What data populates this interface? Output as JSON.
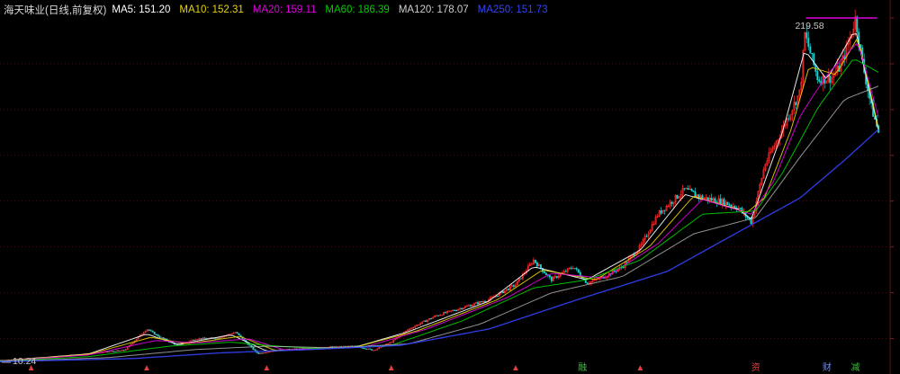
{
  "header": {
    "title": "海天味业",
    "period": "(日线,前复权)"
  },
  "chart_data": {
    "type": "candlestick",
    "max_label": "219.58",
    "min_label": "10.24",
    "y_max": 219.58,
    "y_min": 10.24,
    "ma_legend": [
      {
        "label": "MA5:",
        "value": "151.20",
        "color": "#ffffff"
      },
      {
        "label": "MA10:",
        "value": "152.31",
        "color": "#e8d400"
      },
      {
        "label": "MA20:",
        "value": "159.11",
        "color": "#e000e0"
      },
      {
        "label": "MA60:",
        "value": "186.39",
        "color": "#00d000"
      },
      {
        "label": "MA120:",
        "value": "178.07",
        "color": "#cfcfcf"
      },
      {
        "label": "MA250:",
        "value": "151.73",
        "color": "#3344ff"
      }
    ],
    "series_path": [
      [
        0,
        10.8
      ],
      [
        0.02,
        11.2
      ],
      [
        0.05,
        12.2
      ],
      [
        0.08,
        14.0
      ],
      [
        0.11,
        15.5
      ],
      [
        0.14,
        17.0
      ],
      [
        0.165,
        30.0
      ],
      [
        0.18,
        25.0
      ],
      [
        0.2,
        20.0
      ],
      [
        0.22,
        24.0
      ],
      [
        0.245,
        24.5
      ],
      [
        0.265,
        28.0
      ],
      [
        0.29,
        15.0
      ],
      [
        0.31,
        17.0
      ],
      [
        0.34,
        18.0
      ],
      [
        0.37,
        19.0
      ],
      [
        0.4,
        19.5
      ],
      [
        0.42,
        17.0
      ],
      [
        0.44,
        22.0
      ],
      [
        0.46,
        30.0
      ],
      [
        0.49,
        38.0
      ],
      [
        0.52,
        43.0
      ],
      [
        0.55,
        48.0
      ],
      [
        0.58,
        57.0
      ],
      [
        0.6,
        72.0
      ],
      [
        0.62,
        60.0
      ],
      [
        0.645,
        68.0
      ],
      [
        0.66,
        58.0
      ],
      [
        0.68,
        62.0
      ],
      [
        0.7,
        68.0
      ],
      [
        0.72,
        80.0
      ],
      [
        0.74,
        100.0
      ],
      [
        0.77,
        115.0
      ],
      [
        0.79,
        110.0
      ],
      [
        0.81,
        108.0
      ],
      [
        0.83,
        104.0
      ],
      [
        0.845,
        95.0
      ],
      [
        0.86,
        130.0
      ],
      [
        0.88,
        152.0
      ],
      [
        0.9,
        175.0
      ],
      [
        0.905,
        210.0
      ],
      [
        0.92,
        182.0
      ],
      [
        0.935,
        183.0
      ],
      [
        0.945,
        190.0
      ],
      [
        0.955,
        206.0
      ],
      [
        0.962,
        219.58
      ],
      [
        0.97,
        192.0
      ],
      [
        0.98,
        165.0
      ],
      [
        0.988,
        150.0
      ]
    ],
    "ma_paths": [
      {
        "name": "MA5",
        "color": "#ffffff",
        "values": [
          [
            0,
            10.6
          ],
          [
            0.1,
            14.8
          ],
          [
            0.165,
            27.0
          ],
          [
            0.2,
            20.5
          ],
          [
            0.26,
            26.5
          ],
          [
            0.3,
            16.5
          ],
          [
            0.4,
            19.0
          ],
          [
            0.46,
            28.5
          ],
          [
            0.55,
            47.0
          ],
          [
            0.6,
            68.0
          ],
          [
            0.66,
            60.0
          ],
          [
            0.72,
            78.0
          ],
          [
            0.77,
            112.0
          ],
          [
            0.83,
            103.0
          ],
          [
            0.845,
            97.0
          ],
          [
            0.88,
            150.0
          ],
          [
            0.905,
            200.0
          ],
          [
            0.93,
            182.0
          ],
          [
            0.962,
            213.0
          ],
          [
            0.988,
            151.2
          ]
        ]
      },
      {
        "name": "MA10",
        "color": "#e8d400",
        "values": [
          [
            0,
            10.5
          ],
          [
            0.1,
            14.6
          ],
          [
            0.17,
            25.0
          ],
          [
            0.21,
            21.0
          ],
          [
            0.27,
            25.5
          ],
          [
            0.31,
            16.8
          ],
          [
            0.4,
            19.0
          ],
          [
            0.47,
            29.0
          ],
          [
            0.56,
            48.0
          ],
          [
            0.61,
            66.0
          ],
          [
            0.67,
            60.0
          ],
          [
            0.73,
            80.0
          ],
          [
            0.78,
            111.0
          ],
          [
            0.84,
            101.0
          ],
          [
            0.86,
            110.0
          ],
          [
            0.89,
            152.0
          ],
          [
            0.91,
            190.0
          ],
          [
            0.94,
            185.0
          ],
          [
            0.965,
            208.0
          ],
          [
            0.988,
            152.3
          ]
        ]
      },
      {
        "name": "MA20",
        "color": "#e000e0",
        "values": [
          [
            0,
            10.4
          ],
          [
            0.1,
            14.2
          ],
          [
            0.175,
            23.0
          ],
          [
            0.22,
            21.5
          ],
          [
            0.28,
            24.0
          ],
          [
            0.32,
            17.2
          ],
          [
            0.41,
            19.0
          ],
          [
            0.48,
            30.0
          ],
          [
            0.57,
            49.0
          ],
          [
            0.62,
            64.0
          ],
          [
            0.68,
            61.0
          ],
          [
            0.74,
            82.0
          ],
          [
            0.79,
            109.0
          ],
          [
            0.845,
            100.0
          ],
          [
            0.87,
            120.0
          ],
          [
            0.9,
            160.0
          ],
          [
            0.93,
            185.0
          ],
          [
            0.965,
            205.0
          ],
          [
            0.988,
            159.1
          ]
        ]
      },
      {
        "name": "MA60",
        "color": "#00d000",
        "values": [
          [
            0,
            10.3
          ],
          [
            0.1,
            13.2
          ],
          [
            0.19,
            19.5
          ],
          [
            0.26,
            22.0
          ],
          [
            0.3,
            20.0
          ],
          [
            0.36,
            18.0
          ],
          [
            0.44,
            20.0
          ],
          [
            0.52,
            35.0
          ],
          [
            0.6,
            55.0
          ],
          [
            0.66,
            60.0
          ],
          [
            0.72,
            72.0
          ],
          [
            0.79,
            100.0
          ],
          [
            0.85,
            102.0
          ],
          [
            0.88,
            125.0
          ],
          [
            0.92,
            165.0
          ],
          [
            0.96,
            195.0
          ],
          [
            0.988,
            186.4
          ]
        ]
      },
      {
        "name": "MA120",
        "color": "#cfcfcf",
        "values": [
          [
            0,
            10.2
          ],
          [
            0.12,
            12.5
          ],
          [
            0.22,
            17.5
          ],
          [
            0.3,
            19.5
          ],
          [
            0.38,
            18.5
          ],
          [
            0.46,
            21.0
          ],
          [
            0.54,
            33.0
          ],
          [
            0.62,
            52.0
          ],
          [
            0.7,
            62.0
          ],
          [
            0.78,
            88.0
          ],
          [
            0.85,
            98.0
          ],
          [
            0.9,
            135.0
          ],
          [
            0.95,
            170.0
          ],
          [
            0.988,
            178.1
          ]
        ]
      },
      {
        "name": "MA250",
        "color": "#3344ff",
        "values": [
          [
            0,
            10.1
          ],
          [
            0.15,
            12.0
          ],
          [
            0.25,
            15.5
          ],
          [
            0.35,
            17.5
          ],
          [
            0.45,
            20.0
          ],
          [
            0.55,
            30.0
          ],
          [
            0.65,
            48.0
          ],
          [
            0.75,
            65.0
          ],
          [
            0.84,
            92.0
          ],
          [
            0.9,
            110.0
          ],
          [
            0.95,
            133.0
          ],
          [
            0.988,
            151.7
          ]
        ]
      }
    ],
    "event_markers": [
      {
        "x": 0.035,
        "label": "▲",
        "color": "#e04040"
      },
      {
        "x": 0.165,
        "label": "▲",
        "color": "#e04040"
      },
      {
        "x": 0.3,
        "label": "▲",
        "color": "#e04040"
      },
      {
        "x": 0.44,
        "label": "▲",
        "color": "#e04040"
      },
      {
        "x": 0.58,
        "label": "▲",
        "color": "#e04040"
      },
      {
        "x": 0.655,
        "label": "融",
        "color": "#40c040"
      },
      {
        "x": 0.72,
        "label": "▲",
        "color": "#e04040"
      },
      {
        "x": 0.85,
        "label": "资",
        "color": "#e04040"
      },
      {
        "x": 0.93,
        "label": "财",
        "color": "#6a8cff"
      },
      {
        "x": 0.962,
        "label": "减",
        "color": "#40c040"
      }
    ]
  }
}
